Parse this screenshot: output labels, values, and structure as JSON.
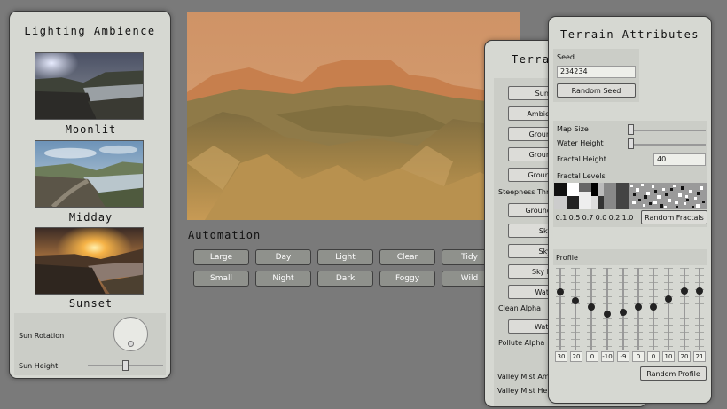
{
  "lighting": {
    "title": "Lighting Ambience",
    "presets": [
      {
        "label": "Moonlit"
      },
      {
        "label": "Midday"
      },
      {
        "label": "Sunset"
      }
    ],
    "sun_rotation_label": "Sun Rotation",
    "sun_height_label": "Sun Height"
  },
  "automation": {
    "title": "Automation",
    "row1": [
      "Large",
      "Day",
      "Light",
      "Clear",
      "Tidy"
    ],
    "row2": [
      "Small",
      "Night",
      "Dark",
      "Foggy",
      "Wild"
    ]
  },
  "terrain_panel": {
    "title": "Terrain",
    "buttons": [
      "Sun Color",
      "Ambient Color",
      "Ground Color",
      "Ground Color",
      "Ground Steep"
    ],
    "steepness_label": "Steepness Thre",
    "buttons2": [
      "Ground Disturb",
      "Sky Top",
      "Sky Mid",
      "Sky Bottom",
      "Water Cle"
    ],
    "clean_alpha_label": "Clean Alpha",
    "water_pol_button": "Water Poll",
    "pollute_alpha_label": "Pollute Alpha",
    "valley_mist_amount_label": "Valley Mist Amou",
    "valley_mist_height_label": "Valley Mist Height"
  },
  "terrain_attributes": {
    "title": "Terrain Attributes",
    "seed_label": "Seed",
    "seed_value": "234234",
    "random_seed_button": "Random Seed",
    "map_size_label": "Map Size",
    "water_height_label": "Water Height",
    "fractal_height_label": "Fractal Height",
    "fractal_height_value": "40",
    "fractal_levels_label": "Fractal Levels",
    "fractal_values": [
      "0.1",
      "0.5",
      "0.7",
      "0.0",
      "0.2",
      "1.0"
    ],
    "random_fractals_button": "Random Fractals",
    "profile_label": "Profile",
    "profile_values": [
      "30",
      "20",
      "0",
      "-10",
      "-9",
      "0",
      "0",
      "10",
      "20",
      "21"
    ],
    "random_profile_button": "Random Profile"
  }
}
